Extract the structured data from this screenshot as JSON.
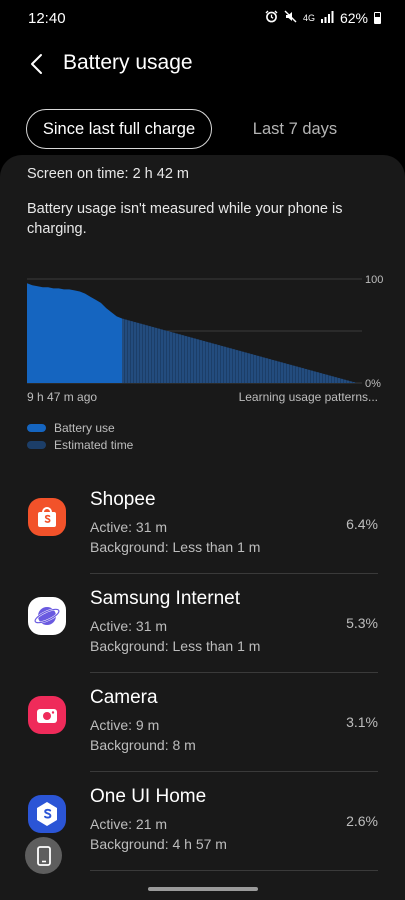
{
  "status_bar": {
    "time": "12:40",
    "network": "4G",
    "battery_pct": "62%"
  },
  "header": {
    "title": "Battery usage"
  },
  "tabs": [
    {
      "label": "Since last full charge",
      "active": true
    },
    {
      "label": "Last 7 days",
      "active": false
    }
  ],
  "screen_on_time": "Screen on time: 2 h 42 m",
  "notice": "Battery usage isn't measured while your phone is charging.",
  "chart_data": {
    "type": "area",
    "y_ticks": [
      "100",
      "0%"
    ],
    "ylim": [
      0,
      100
    ],
    "x_start_label": "9 h 47 m ago",
    "x_end_label": "Learning usage patterns...",
    "series": [
      {
        "name": "Battery use",
        "color": "#1565c0",
        "values": [
          96,
          94,
          93,
          92,
          92,
          91,
          91,
          90,
          90,
          89,
          88,
          86,
          83,
          80,
          77,
          72,
          68,
          64,
          62
        ]
      },
      {
        "name": "Estimated time",
        "color": "#1c3e68",
        "start": 62,
        "end": 0
      }
    ],
    "legend": [
      {
        "label": "Battery use",
        "color": "#1565c0"
      },
      {
        "label": "Estimated time",
        "color": "#1c3e68"
      }
    ]
  },
  "apps": [
    {
      "name": "Shopee",
      "active": "Active: 31 m",
      "background": "Background: Less than 1 m",
      "percent": "6.4%",
      "icon": "shopee-icon",
      "color": "#f2522a"
    },
    {
      "name": "Samsung Internet",
      "active": "Active: 31 m",
      "background": "Background: Less than 1 m",
      "percent": "5.3%",
      "icon": "samsung-internet-icon",
      "color": "#6a5ae0"
    },
    {
      "name": "Camera",
      "active": "Active: 9 m",
      "background": "Background: 8 m",
      "percent": "3.1%",
      "icon": "camera-icon",
      "color": "#ef2b5a"
    },
    {
      "name": "One UI Home",
      "active": "Active: 21 m",
      "background": "Background: 4 h 57 m",
      "percent": "2.6%",
      "icon": "one-ui-home-icon",
      "color": "#2b55d6"
    }
  ]
}
